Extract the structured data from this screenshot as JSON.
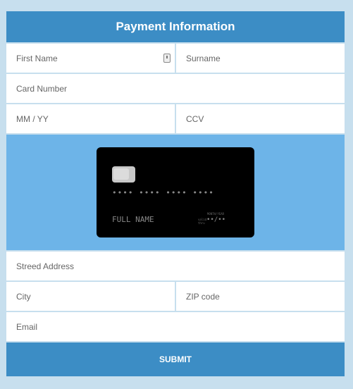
{
  "header": {
    "title": "Payment Information"
  },
  "fields": {
    "first_name": {
      "placeholder": "First Name",
      "value": ""
    },
    "surname": {
      "placeholder": "Surname",
      "value": ""
    },
    "card_number": {
      "placeholder": "Card Number",
      "value": ""
    },
    "expiry": {
      "placeholder": "MM / YY",
      "value": ""
    },
    "ccv": {
      "placeholder": "CCV",
      "value": ""
    },
    "street": {
      "placeholder": "Streed Address",
      "value": ""
    },
    "city": {
      "placeholder": "City",
      "value": ""
    },
    "zip": {
      "placeholder": "ZIP code",
      "value": ""
    },
    "email": {
      "placeholder": "Email",
      "value": ""
    }
  },
  "card": {
    "number": "•••• •••• •••• ••••",
    "name": "FULL NAME",
    "month_year_label": "MONTH/YEAR",
    "valid_thru_label": "valid thru",
    "expiry": "••/••"
  },
  "submit_label": "SUBMIT",
  "colors": {
    "primary": "#3c8dc5",
    "card_area": "#6db4e8",
    "background": "#c7dfee"
  }
}
